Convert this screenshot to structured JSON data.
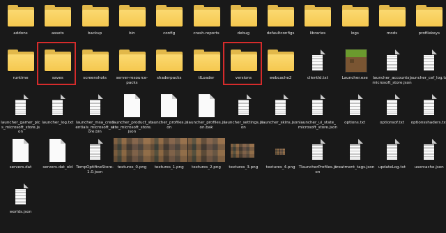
{
  "window": {
    "background": "#191919",
    "highlight_color": "#d62b2b",
    "folder_color": "#f5c84f"
  },
  "items": [
    {
      "label": "addons",
      "kind": "folder"
    },
    {
      "label": "assets",
      "kind": "folder"
    },
    {
      "label": "backup",
      "kind": "folder"
    },
    {
      "label": "bin",
      "kind": "folder"
    },
    {
      "label": "config",
      "kind": "folder"
    },
    {
      "label": "crash-reports",
      "kind": "folder"
    },
    {
      "label": "debug",
      "kind": "folder"
    },
    {
      "label": "defaultconfigs",
      "kind": "folder"
    },
    {
      "label": "libraries",
      "kind": "folder"
    },
    {
      "label": "logs",
      "kind": "folder"
    },
    {
      "label": "mods",
      "kind": "folder"
    },
    {
      "label": "profilekeys",
      "kind": "folder"
    },
    {
      "label": "runtime",
      "kind": "folder"
    },
    {
      "label": "saves",
      "kind": "folder",
      "highlighted": true
    },
    {
      "label": "screenshots",
      "kind": "folder"
    },
    {
      "label": "server-resource-packs",
      "kind": "folder"
    },
    {
      "label": "shaderpacks",
      "kind": "folder"
    },
    {
      "label": "tlLoader",
      "kind": "folder"
    },
    {
      "label": "versions",
      "kind": "folder",
      "highlighted": true
    },
    {
      "label": "webcache2",
      "kind": "folder"
    },
    {
      "label": "clientId.txt",
      "kind": "text"
    },
    {
      "label": "Launcher.exe",
      "kind": "exe"
    },
    {
      "label": "launcher_accounts_microsoft_store.json",
      "kind": "text"
    },
    {
      "label": "launcher_cef_log.txt",
      "kind": "text"
    },
    {
      "label": "launcher_gamer_pics_microsoft_store.json",
      "kind": "text"
    },
    {
      "label": "launcher_log.txt",
      "kind": "text"
    },
    {
      "label": "launcher_msa_credentials_microsoft_store.bin",
      "kind": "text"
    },
    {
      "label": "launcher_product_state_microsoft_store.json",
      "kind": "blank"
    },
    {
      "label": "launcher_profiles.json",
      "kind": "blank"
    },
    {
      "label": "launcher_profiles.json.bak",
      "kind": "blank"
    },
    {
      "label": "launcher_settings.json",
      "kind": "text"
    },
    {
      "label": "launcher_skins.json",
      "kind": "text"
    },
    {
      "label": "launcher_ui_state_microsoft_store.json",
      "kind": "text"
    },
    {
      "label": "options.txt",
      "kind": "text"
    },
    {
      "label": "optionsof.txt",
      "kind": "text"
    },
    {
      "label": "optionsshaders.txt",
      "kind": "text"
    },
    {
      "label": "servers.dat",
      "kind": "blank"
    },
    {
      "label": "servers.dat_old",
      "kind": "blank"
    },
    {
      "label": "TempOptifineStore-1.0.json",
      "kind": "text"
    },
    {
      "label": "textures_0.png",
      "kind": "image"
    },
    {
      "label": "textures_1.png",
      "kind": "image"
    },
    {
      "label": "textures_2.png",
      "kind": "image"
    },
    {
      "label": "textures_3.png",
      "kind": "image-small"
    },
    {
      "label": "textures_4.png",
      "kind": "image-tiny"
    },
    {
      "label": "TlauncherProfiles.json",
      "kind": "text"
    },
    {
      "label": "treatment_tags.json",
      "kind": "text"
    },
    {
      "label": "updateLog.txt",
      "kind": "text"
    },
    {
      "label": "usercache.json",
      "kind": "text"
    },
    {
      "label": "worlds.json",
      "kind": "text"
    }
  ]
}
